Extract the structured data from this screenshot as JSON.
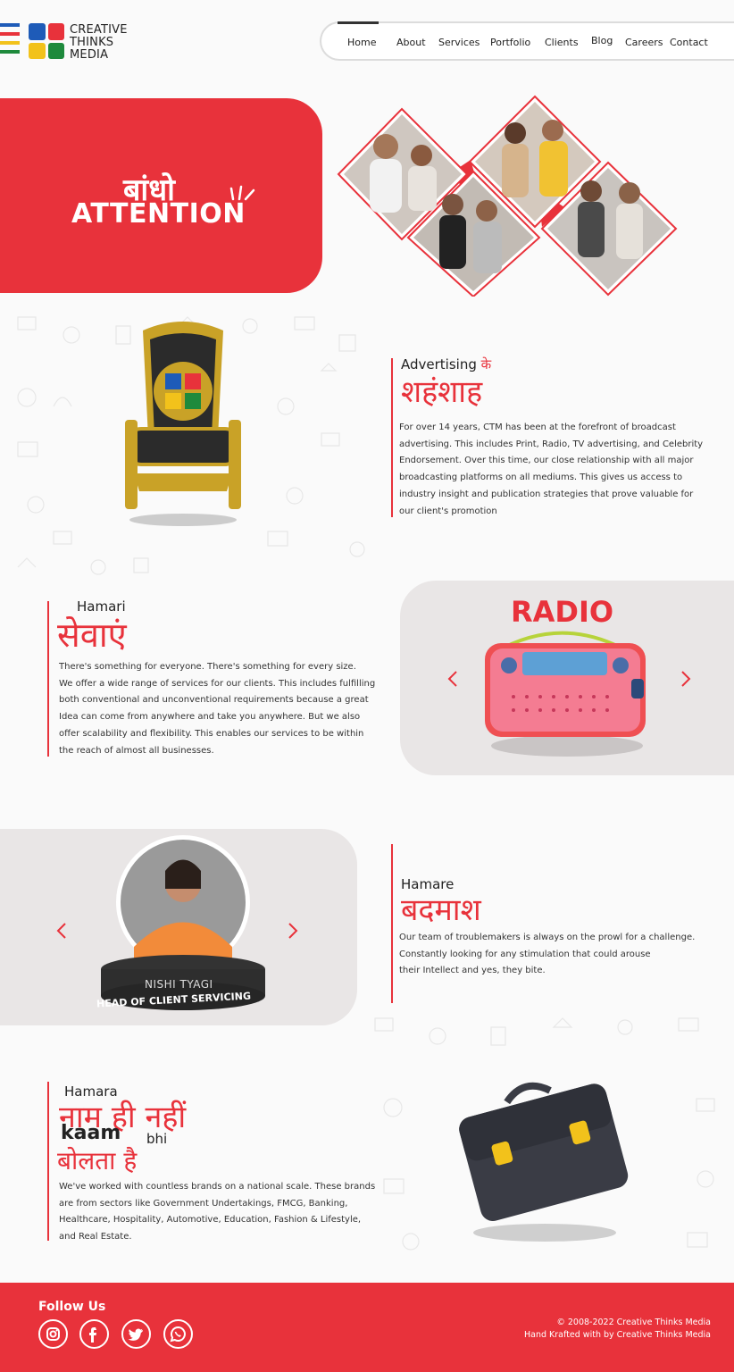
{
  "brand": {
    "name_lines": [
      "CREATIVE",
      "THINKS",
      "MEDIA"
    ],
    "colors": {
      "red": "#e8323b",
      "blue": "#1e5bb8",
      "yellow": "#f2c21b",
      "green": "#1e8a3c"
    }
  },
  "nav": {
    "items": [
      "Home",
      "About",
      "Services",
      "Portfolio",
      "Clients",
      "Blog",
      "Careers",
      "Contact"
    ],
    "active": "Home"
  },
  "hero": {
    "hindi": "बांधो",
    "english": "ATTENTION"
  },
  "about": {
    "eng_heading": "Advertising",
    "hindi_suffix": "के",
    "hindi_heading": "शहंशाह",
    "paragraph_lines": [
      "For over 14 years, CTM has been at the forefront of broadcast",
      "advertising. This includes Print, Radio, TV advertising, and Celebrity",
      "Endorsement.  Over this time, our close relationship with all major",
      "broadcasting platforms on all mediums. This gives us access to",
      "industry insight and publication strategies that prove valuable for",
      "our client's promotion"
    ]
  },
  "services": {
    "eng_heading": "Hamari",
    "hindi_heading": "सेवाएं",
    "paragraph_lines": [
      "There's something for everyone. There's something for every size.",
      "We offer a wide range of services for our clients. This includes fulfilling",
      "both conventional and unconventional requirements because a great",
      "Idea can come from anywhere and take you anywhere. But we also",
      "offer scalability and flexibility. This enables our services to be within",
      "the reach of almost all businesses."
    ],
    "carousel_title": "RADIO",
    "prev_icon": "chevron-left-icon",
    "next_icon": "chevron-right-icon"
  },
  "team": {
    "eng_heading": "Hamare",
    "hindi_heading": "बदमाश",
    "paragraph_lines": [
      "Our team of troublemakers is always on the prowl for a challenge.",
      "Constantly looking for any stimulation that could arouse",
      "their Intellect and yes, they bite."
    ],
    "member_name": "NISHI TYAGI",
    "member_role": "HEAD OF CLIENT SERVICING"
  },
  "work": {
    "eng_heading": "Hamara",
    "hindi_line1": "नाम ही नहीं",
    "kaam": "kaam",
    "bhi": "bhi",
    "hindi_line2": "बोलता है",
    "paragraph_lines": [
      "We've worked with countless brands on a national scale. These brands",
      "are from sectors like Government Undertakings, FMCG, Banking,",
      "Healthcare, Hospitality, Automotive, Education, Fashion & Lifestyle,",
      "and Real Estate."
    ]
  },
  "footer": {
    "follow_label": "Follow Us",
    "social": [
      "instagram-icon",
      "facebook-icon",
      "twitter-icon",
      "whatsapp-icon"
    ],
    "copyright": "© 2008-2022 Creative Thinks Media",
    "credit": "Hand Krafted with  by Creative Thinks Media"
  }
}
